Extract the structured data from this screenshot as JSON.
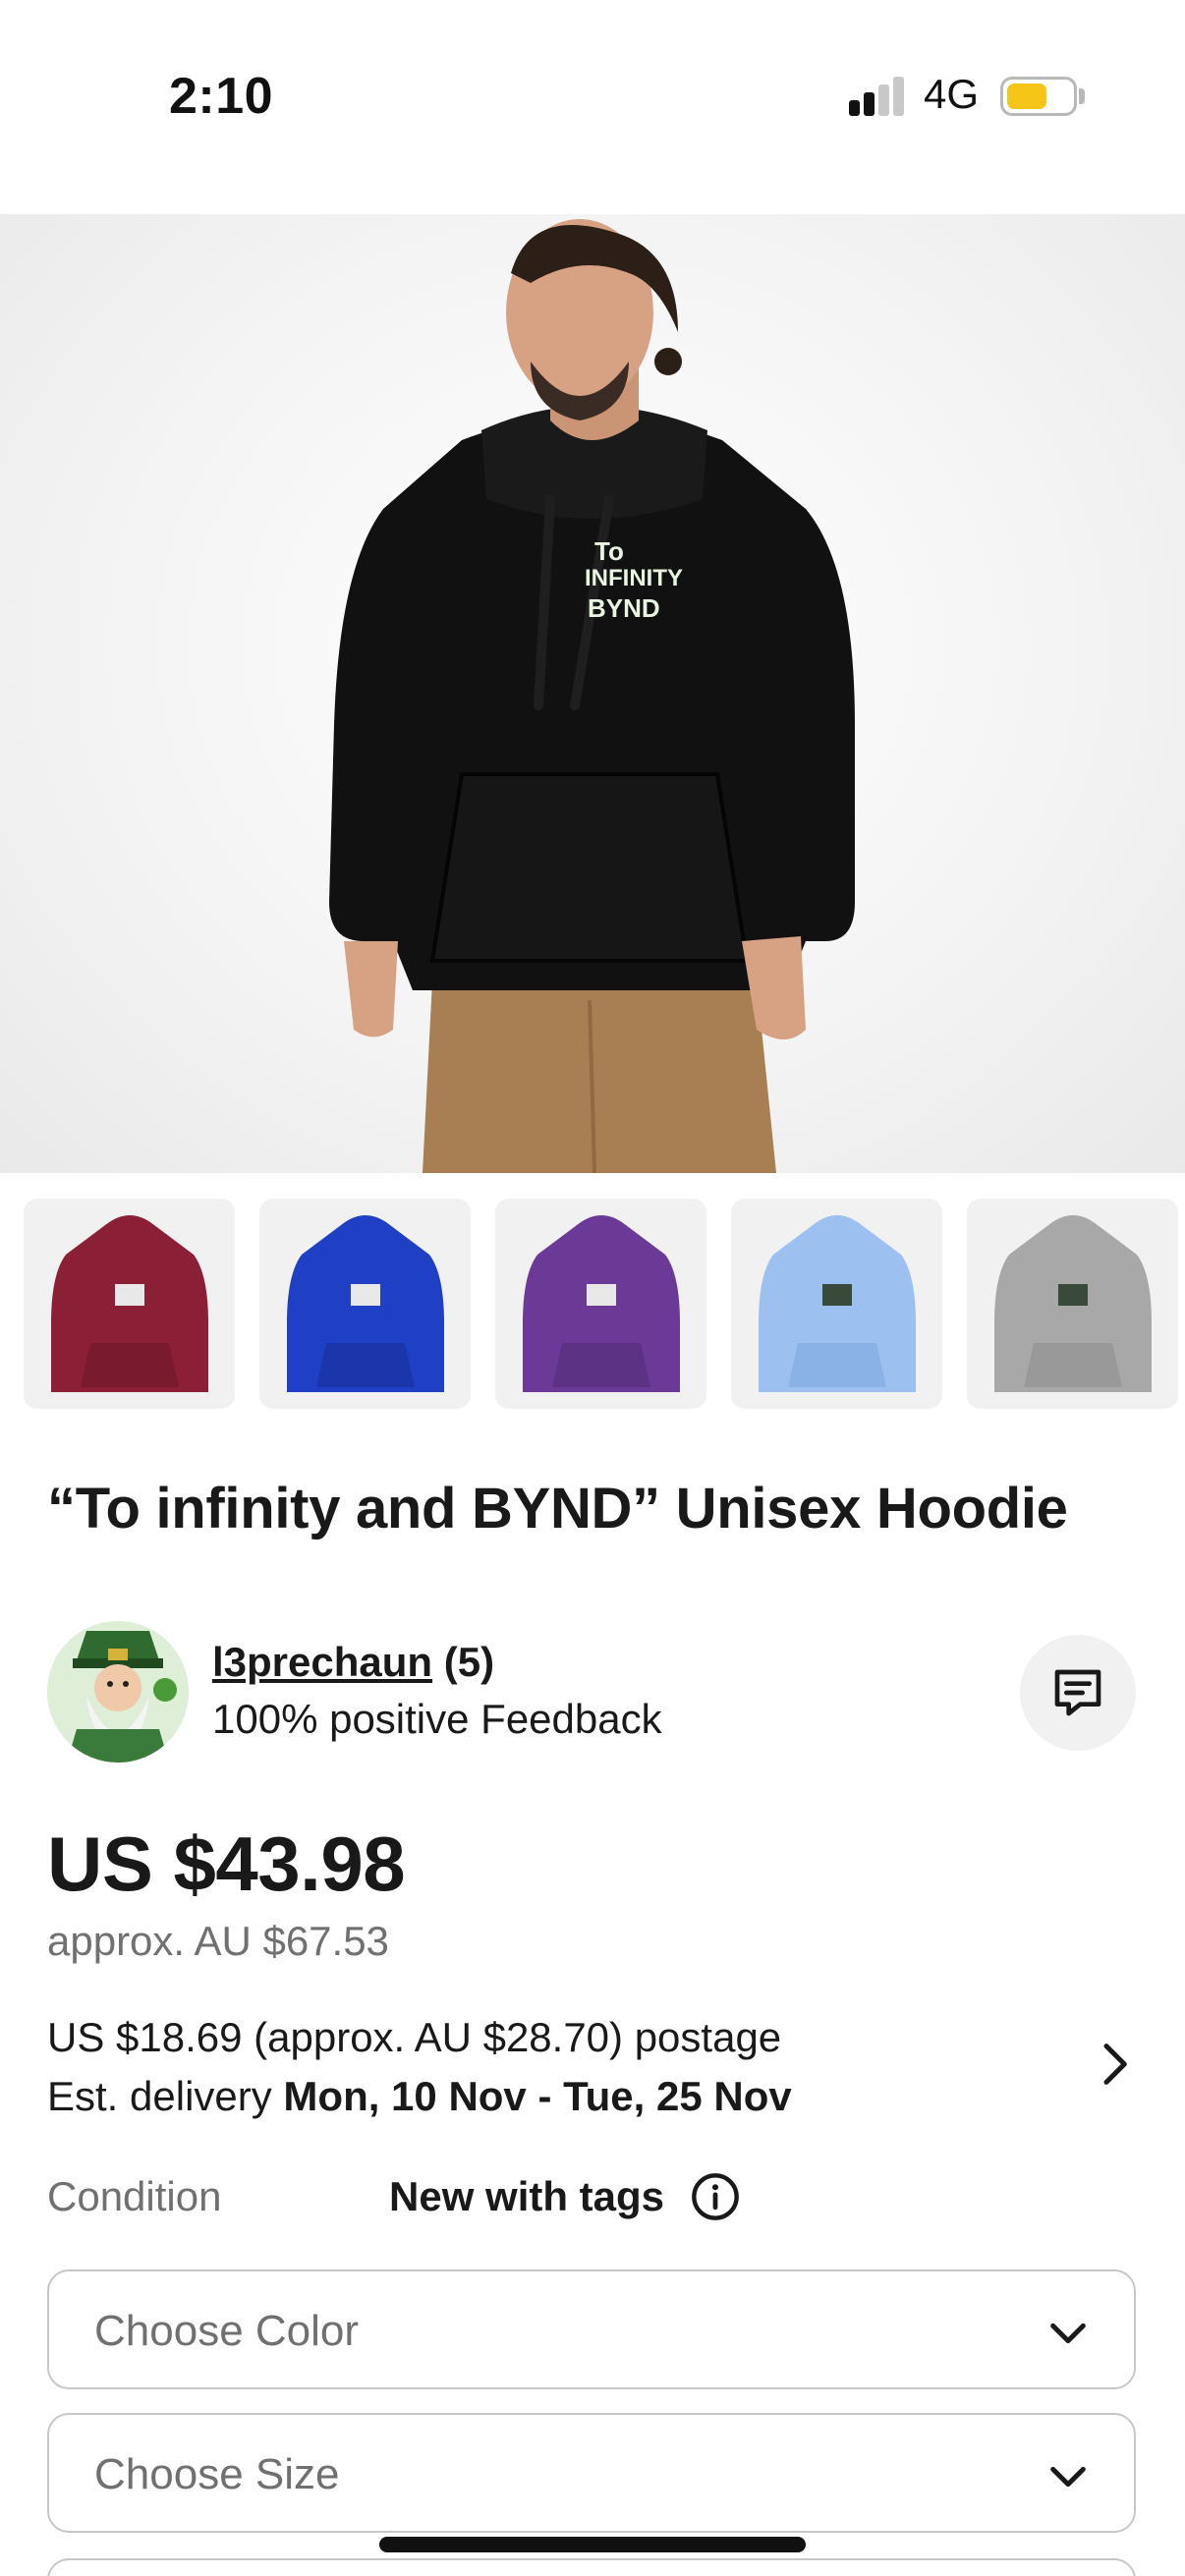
{
  "status_bar": {
    "time": "2:10",
    "network": "4G"
  },
  "listing": {
    "title": "“To infinity and BYND” Unisex Hoodie",
    "image_print_text": "To INFINITY AND BYND",
    "thumbnail_colors": [
      "#8a1f35",
      "#1f3fc4",
      "#6a3a96",
      "#9cc0ef",
      "#a8a8a8"
    ]
  },
  "seller": {
    "name": "l3prechaun",
    "count": "(5)",
    "feedback": "100% positive Feedback"
  },
  "price": {
    "main": "US $43.98",
    "approx": "approx. AU $67.53"
  },
  "shipping": {
    "postage": "US $18.69 (approx. AU $28.70) postage",
    "delivery_prefix": "Est. delivery ",
    "delivery_dates": "Mon, 10 Nov - Tue, 25 Nov"
  },
  "condition": {
    "label": "Condition",
    "value": "New with tags"
  },
  "selects": {
    "color_placeholder": "Choose Color",
    "size_placeholder": "Choose Size"
  },
  "icons": {
    "favorite": "heart-icon",
    "message": "chat-icon",
    "info": "info-icon",
    "chevron": "chevron-right-icon",
    "dropdown": "chevron-down-icon"
  }
}
